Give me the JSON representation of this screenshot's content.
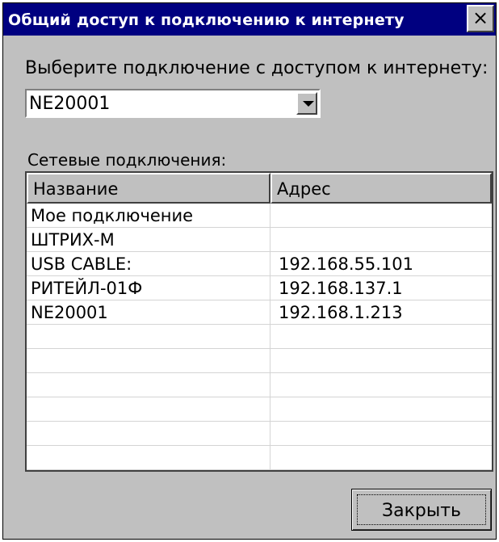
{
  "window": {
    "title": "Общий доступ к подключению к интернету",
    "close_glyph": "×"
  },
  "prompt": {
    "label": "Выберите подключение с доступом к интернету:",
    "selected_connection": "NE20001"
  },
  "connections": {
    "label": "Сетевые подключения:",
    "columns": [
      "Название",
      "Адрес"
    ],
    "rows": [
      {
        "name": "Мое подключение",
        "address": ""
      },
      {
        "name": "ШТРИХ-М",
        "address": ""
      },
      {
        "name": "USB CABLE:",
        "address": "192.168.55.101"
      },
      {
        "name": "РИТЕЙЛ-01Ф",
        "address": "192.168.137.1"
      },
      {
        "name": "NE20001",
        "address": "192.168.1.213"
      },
      {
        "name": "",
        "address": ""
      },
      {
        "name": "",
        "address": ""
      },
      {
        "name": "",
        "address": ""
      },
      {
        "name": "",
        "address": ""
      },
      {
        "name": "",
        "address": ""
      },
      {
        "name": "",
        "address": ""
      }
    ]
  },
  "footer": {
    "close_label": "Закрыть"
  }
}
